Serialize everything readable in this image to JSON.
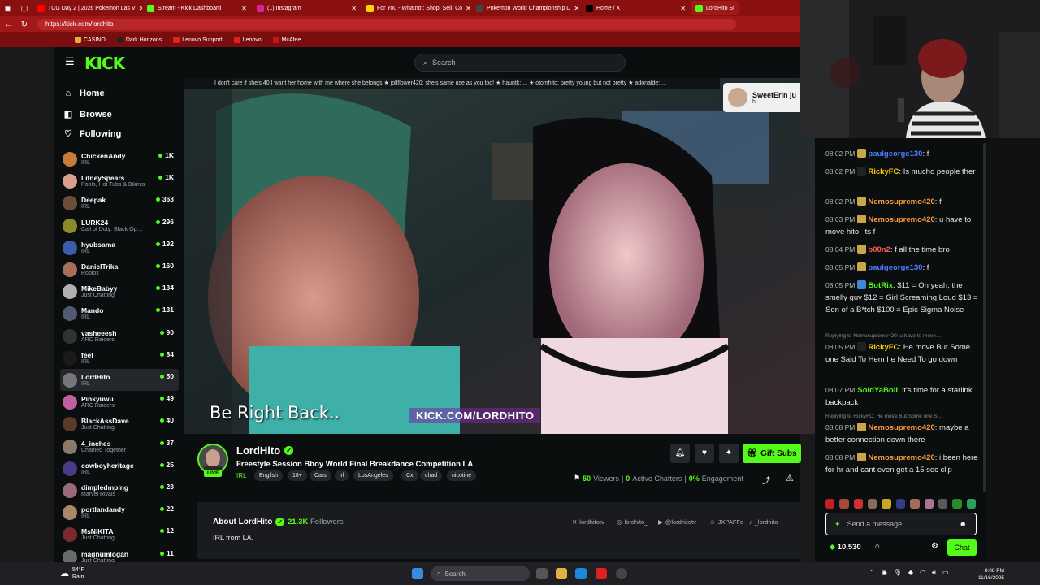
{
  "browser": {
    "tabs": [
      {
        "label": "TCG Day 2 | 2026 Pokemon Las V",
        "color": "#ff0000"
      },
      {
        "label": "Stream - Kick Dashboard",
        "color": "#53fc18"
      },
      {
        "label": "(1) Instagram",
        "color": "#d6249f"
      },
      {
        "label": "For You - Whatnot: Shop, Sell, Co",
        "color": "#ffd400"
      },
      {
        "label": "Pokemon World Championship D",
        "color": "#444444"
      },
      {
        "label": "Home / X",
        "color": "#000000"
      },
      {
        "label": "LordHito St",
        "color": "#53fc18"
      }
    ],
    "url": "https://kick.com/lordhito",
    "bookmarks": [
      "CASINO",
      "Dark Horizons",
      "Lenovo Support",
      "Lenovo",
      "McAfee"
    ]
  },
  "kick": {
    "logo": "KICK",
    "search_placeholder": "Search",
    "nav": [
      "Home",
      "Browse",
      "Following"
    ]
  },
  "channels": [
    {
      "name": "ChickenAndy",
      "category": "IRL",
      "viewers": "1K",
      "color": "#c77b3a"
    },
    {
      "name": "LitneySpears",
      "category": "Pools, Hot Tubs & Bikinis",
      "viewers": "1K",
      "color": "#d9a08a"
    },
    {
      "name": "Deepak",
      "category": "IRL",
      "viewers": "363",
      "color": "#6c4d3a"
    },
    {
      "name": "LURK24",
      "category": "Call of Duty: Black Op…",
      "viewers": "296",
      "color": "#8a8a2a"
    },
    {
      "name": "hyubsama",
      "category": "IRL",
      "viewers": "192",
      "color": "#3a5ea8"
    },
    {
      "name": "DanielTrika",
      "category": "Roblox",
      "viewers": "160",
      "color": "#a86f5a"
    },
    {
      "name": "MikeBabyy",
      "category": "Just Chatting",
      "viewers": "134",
      "color": "#b0b0b0"
    },
    {
      "name": "Mando",
      "category": "IRL",
      "viewers": "131",
      "color": "#505a70"
    },
    {
      "name": "vasheeesh",
      "category": "ARC Raiders",
      "viewers": "90",
      "color": "#333333"
    },
    {
      "name": "feef",
      "category": "IRL",
      "viewers": "84",
      "color": "#1a1a1a"
    },
    {
      "name": "LordHito",
      "category": "IRL",
      "viewers": "50",
      "color": "#777777"
    },
    {
      "name": "Pinkyuwu",
      "category": "ARC Raiders",
      "viewers": "49",
      "color": "#c060a0"
    },
    {
      "name": "BlackAssDave",
      "category": "Just Chatting",
      "viewers": "40",
      "color": "#5a3a2a"
    },
    {
      "name": "4_inches",
      "category": "Chained Together",
      "viewers": "37",
      "color": "#8a7a6a"
    },
    {
      "name": "cowboyheritage",
      "category": "IRL",
      "viewers": "25",
      "color": "#4a3a8a"
    },
    {
      "name": "dimpledmping",
      "category": "Marvel Rivals",
      "viewers": "23",
      "color": "#9a6a7a"
    },
    {
      "name": "portlandandy",
      "category": "IRL",
      "viewers": "22",
      "color": "#aa8866"
    },
    {
      "name": "MsNiKITA",
      "category": "Just Chatting",
      "viewers": "12",
      "color": "#7a2a2a"
    },
    {
      "name": "magnumlogan",
      "category": "Just Chatting",
      "viewers": "11",
      "color": "#6a6a6a"
    }
  ],
  "video": {
    "chat_overlay": "I don't care if she's 40 I want her home with me where she belongs   ★ jollflower420: she's same use as you too!   ★ hauntk: ...   ★ otomhito: pretty young but not pretty   ★ adonalde: ...",
    "brb_text": "Be Right Back..",
    "kick_url": "KICK.COM/LORDHITO",
    "alert_name": "SweetErin ju",
    "alert_msg": "hi"
  },
  "stream": {
    "name": "LordHito",
    "live_label": "LIVE",
    "title": "Freestyle Session Bboy World Final Breakdance Competition LA",
    "category": "IRL",
    "tags": [
      "English",
      "18+",
      "Cars",
      "irl",
      "LosAngeles",
      "Cx",
      "chad",
      "nicotine"
    ],
    "gift_label": "Gift Subs",
    "viewers": "50",
    "viewers_label": "Viewers",
    "chatters": "0",
    "chatters_label": "Active Chatters",
    "engagement": "0%",
    "engagement_label": "Engagement"
  },
  "about": {
    "title": "About LordHito",
    "followers": "21.3K",
    "followers_label": "Followers",
    "bio": "IRL from LA.",
    "socials": [
      "lordhitotv",
      "lordhito_",
      "@lordhitotv",
      "JXPAFFc",
      "_lordhito"
    ]
  },
  "chat": {
    "messages": [
      {
        "time": "08:02 PM",
        "user": "paulgeorge130",
        "color": "#4a7eff",
        "badge": "#c9a64a",
        "text": "f"
      },
      {
        "time": "08:02 PM",
        "user": "RickyFC",
        "color": "#ffd400",
        "badge": "#222222",
        "text": "Is mucho people ther"
      },
      {
        "time": "08:02 PM",
        "user": "Nemosupremo420",
        "color": "#ff9a3c",
        "badge": "#c9a64a",
        "text": "f"
      },
      {
        "time": "08:03 PM",
        "user": "Nemosupremo420",
        "color": "#ff9a3c",
        "badge": "#c9a64a",
        "text": "u have to move hito. its f"
      },
      {
        "time": "08:04 PM",
        "user": "b00n2",
        "color": "#ff5a5a",
        "badge": "#c9a64a",
        "text": "f all the time bro"
      },
      {
        "time": "08:05 PM",
        "user": "paulgeorge130",
        "color": "#4a7eff",
        "badge": "#c9a64a",
        "text": "f"
      },
      {
        "time": "08:05 PM",
        "user": "BotRix",
        "color": "#53fc18",
        "badge": "#3a8ad8",
        "text": "$11 = Oh yeah, the smelly guy $12 = Girl Screaming Loud $13 = Son of a B*tch $100 = Epic Sigma Noise"
      },
      {
        "time": "08:05 PM",
        "user": "RickyFC",
        "color": "#ffd400",
        "badge": "#222222",
        "text": "He move But Some one Said To Hem he Need To go down",
        "reply": "Replying to Nemosupremo420: u have to move…"
      },
      {
        "time": "08:07 PM",
        "user": "SoldYaBoii",
        "color": "#53fc18",
        "badge": "",
        "text": "it's time for a starlink backpack"
      },
      {
        "time": "08:08 PM",
        "user": "Nemosupremo420",
        "color": "#ff9a3c",
        "badge": "#c9a64a",
        "text": "maybe a better connection down there",
        "reply": "Replying to RickyFC: He move But Some one S…"
      },
      {
        "time": "08:08 PM",
        "user": "Nemosupremo420",
        "color": "#ff9a3c",
        "badge": "#c9a64a",
        "text": "i been here for hr and cant even get a 15 sec clip"
      }
    ],
    "input_placeholder": "Send a message",
    "points": "10,530",
    "chat_button": "Chat"
  },
  "taskbar": {
    "temp": "54°F",
    "weather": "Rain",
    "search": "Search",
    "time": "8:08 PM",
    "date": "11/16/2025"
  }
}
